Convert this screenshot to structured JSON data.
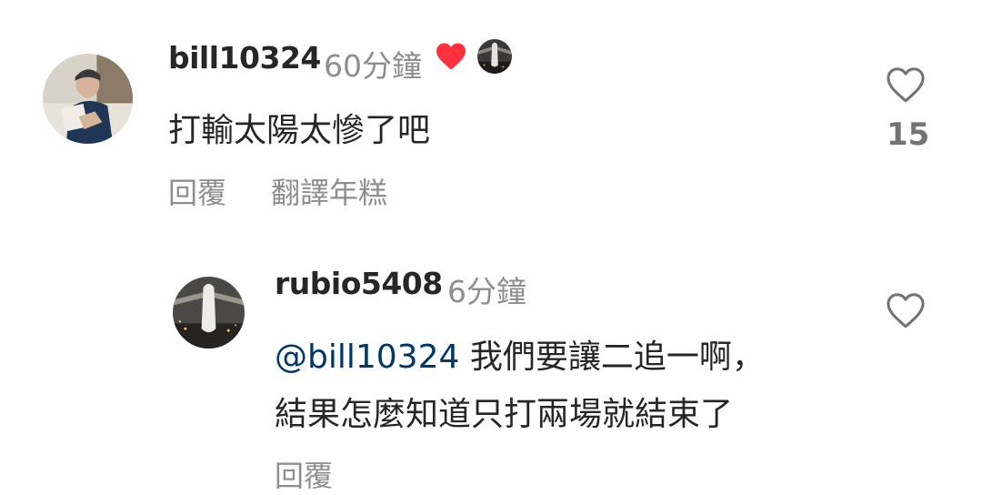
{
  "comments": [
    {
      "username": "bill10324",
      "timestamp": "60分鐘",
      "text": "打輸太陽太慘了吧",
      "reply_label": "回覆",
      "translate_label": "翻譯年糕",
      "like_count": "15",
      "liked_by_creator": true,
      "colors": {
        "heart": "#ff3040"
      }
    },
    {
      "username": "rubio5408",
      "timestamp": "6分鐘",
      "mention": "@bill10324",
      "text_line1": " 我們要讓二追一啊，",
      "text_line2": "結果怎麼知道只打兩場就結束了",
      "reply_label": "回覆",
      "colors": {
        "mention": "#00376b"
      }
    }
  ]
}
